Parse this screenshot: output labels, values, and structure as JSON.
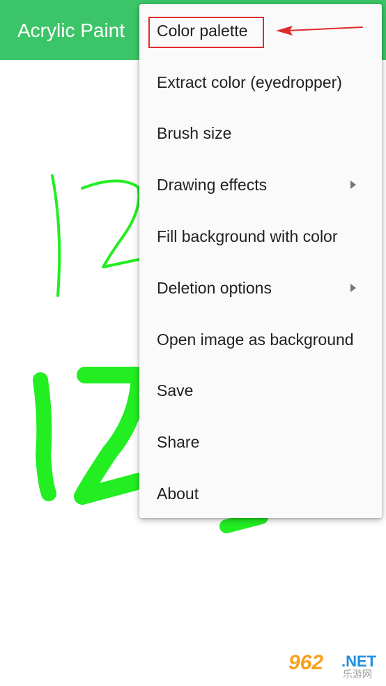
{
  "app_bar": {
    "title": "Acrylic Paint",
    "background_color": "#3cc568"
  },
  "drawing": {
    "stroke_color": "#22ee22",
    "description_icon": "handwritten-12-strokes"
  },
  "overflow_menu": {
    "items": [
      {
        "label": "Color palette",
        "has_submenu": false
      },
      {
        "label": "Extract color (eyedropper)",
        "has_submenu": false
      },
      {
        "label": "Brush size",
        "has_submenu": false
      },
      {
        "label": "Drawing effects",
        "has_submenu": true
      },
      {
        "label": "Fill background with color",
        "has_submenu": false
      },
      {
        "label": "Deletion options",
        "has_submenu": true
      },
      {
        "label": "Open image as background",
        "has_submenu": false
      },
      {
        "label": "Save",
        "has_submenu": false
      },
      {
        "label": "Share",
        "has_submenu": false
      },
      {
        "label": "About",
        "has_submenu": false
      }
    ],
    "submenu_icon": "triangle-right-icon"
  },
  "annotation": {
    "highlight_color": "#e02b2b",
    "arrow_icon": "red-arrow-icon"
  },
  "watermark": {
    "main_text": "962",
    "suffix_text": ".NET",
    "sub_text": "乐游网"
  }
}
